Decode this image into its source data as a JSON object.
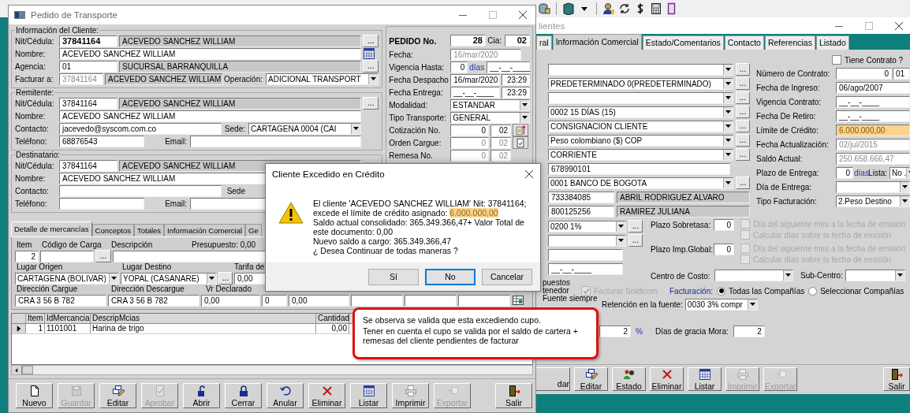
{
  "pedido": {
    "title": "Pedido de Transporte",
    "sections": [
      {
        "legend": "Información del Cliente:",
        "rows": [
          [
            {
              "kind": "label",
              "text": "Nit/Cédula:"
            },
            {
              "kind": "key",
              "text": "37841164"
            },
            {
              "kind": "readonly",
              "text": "ACEVEDO SANCHEZ WILLIAM"
            },
            {
              "kind": "button",
              "text": "..."
            }
          ],
          [
            {
              "kind": "label",
              "text": "Nombre:"
            },
            {
              "kind": "field",
              "text": "ACEVEDO SANCHEZ WILLIAM"
            }
          ],
          [
            {
              "kind": "label",
              "text": "Agencia:"
            },
            {
              "kind": "field",
              "text": "01"
            },
            {
              "kind": "readonly",
              "text": "SUCURSAL BARRANQUILLA"
            },
            {
              "kind": "button",
              "text": "..."
            }
          ],
          [
            {
              "kind": "label",
              "text": "Facturar a:"
            },
            {
              "kind": "field-grey",
              "text": "37841164"
            },
            {
              "kind": "readonly",
              "text": "ACEVEDO SANCHEZ WILLIAM"
            },
            {
              "kind": "label",
              "text": "Operación:"
            },
            {
              "kind": "combo",
              "text": "ADICIONAL TRANSPORT"
            }
          ]
        ]
      },
      {
        "legend": "Remitente:",
        "rows": [
          [
            {
              "kind": "label",
              "text": "Nit/Cédula:"
            },
            {
              "kind": "field",
              "text": "37841164"
            },
            {
              "kind": "readonly",
              "text": "ACEVEDO SANCHEZ WILLIAM"
            },
            {
              "kind": "button",
              "text": "..."
            }
          ],
          [
            {
              "kind": "label",
              "text": "Nombre:"
            },
            {
              "kind": "field",
              "text": "ACEVEDO SANCHEZ WILLIAM"
            }
          ],
          [
            {
              "kind": "label",
              "text": "Contacto:"
            },
            {
              "kind": "field",
              "text": "jacevedo@syscom.com.co"
            },
            {
              "kind": "label",
              "text": "Sede:"
            },
            {
              "kind": "combo",
              "text": "CARTAGENA 0004 (CAI"
            }
          ],
          [
            {
              "kind": "label",
              "text": "Teléfono:"
            },
            {
              "kind": "field",
              "text": "68876543"
            },
            {
              "kind": "label",
              "text": "Email:"
            },
            {
              "kind": "field"
            }
          ]
        ]
      },
      {
        "legend": "Destinatario:",
        "rows": [
          [
            {
              "kind": "label",
              "text": "Nit/Cédula:"
            },
            {
              "kind": "field",
              "text": "37841164"
            },
            {
              "kind": "readonly",
              "text": "ACEVEDO SANCHEZ WILLIAM"
            }
          ],
          [
            {
              "kind": "label",
              "text": "Nombre:"
            },
            {
              "kind": "field",
              "text": "ACEVEDO SANCHEZ WILLIAM"
            }
          ],
          [
            {
              "kind": "label",
              "text": "Contacto:"
            },
            {
              "kind": "field"
            },
            {
              "kind": "label",
              "text": "Sede"
            }
          ],
          [
            {
              "kind": "label",
              "text": "Teléfono:"
            },
            {
              "kind": "field"
            },
            {
              "kind": "label",
              "text": "Email:"
            },
            {
              "kind": "field"
            }
          ]
        ]
      }
    ],
    "order": [
      [
        {
          "kind": "strong",
          "text": "PEDIDO No."
        },
        {
          "kind": "key-number",
          "text": "28"
        },
        {
          "kind": "label",
          "text": "Cia:"
        },
        {
          "kind": "key-number",
          "text": "02"
        }
      ],
      [
        {
          "kind": "label",
          "text": "Fecha:"
        },
        {
          "kind": "field-grey",
          "text": "16/mar/2020"
        }
      ],
      [
        {
          "kind": "label",
          "text": "Vigencia Hasta:"
        },
        {
          "kind": "number",
          "text": "0"
        },
        {
          "kind": "unit",
          "text": "días"
        },
        {
          "kind": "field",
          "text": "__-__-____"
        }
      ],
      [
        {
          "kind": "label",
          "text": "Fecha Despacho"
        },
        {
          "kind": "field",
          "text": "16/mar/2020"
        },
        {
          "kind": "number",
          "text": "23:29"
        }
      ],
      [
        {
          "kind": "label",
          "text": "Fecha Entrega:"
        },
        {
          "kind": "field",
          "text": "__-__-____"
        },
        {
          "kind": "number",
          "text": "23:29"
        }
      ],
      [
        {
          "kind": "label",
          "text": "Modalidad:"
        },
        {
          "kind": "combo",
          "text": "ESTANDAR"
        }
      ],
      [
        {
          "kind": "label",
          "text": "Tipo Transporte:"
        },
        {
          "kind": "combo",
          "text": "GENERAL"
        }
      ],
      [
        {
          "kind": "label",
          "text": "Cotización No."
        },
        {
          "kind": "number",
          "text": "0"
        },
        {
          "kind": "number",
          "text": "02"
        }
      ],
      [
        {
          "kind": "label",
          "text": "Orden Cargue:"
        },
        {
          "kind": "number-grey",
          "text": "0"
        },
        {
          "kind": "number-grey",
          "text": "02"
        }
      ],
      [
        {
          "kind": "label",
          "text": "Remesa No."
        },
        {
          "kind": "number-grey",
          "text": "0"
        },
        {
          "kind": "number-grey",
          "text": "02"
        }
      ]
    ],
    "tabs": [
      {
        "label": "Detalle de mercancías",
        "selected": true
      },
      {
        "label": "Conceptos",
        "selected": false
      },
      {
        "label": "Totales",
        "selected": false
      },
      {
        "label": "Información Comercial",
        "selected": false
      },
      {
        "label": "Ge",
        "selected": false
      }
    ],
    "detail": [
      [
        {
          "kind": "label",
          "text": "Item"
        },
        {
          "kind": "label",
          "text": "Código de Carga"
        },
        {
          "kind": "label",
          "text": "Descripción"
        },
        {
          "kind": "label",
          "text": "Presupuesto: 0,00"
        }
      ],
      [
        {
          "kind": "number",
          "text": "2"
        },
        {
          "kind": "field"
        },
        {
          "kind": "button",
          "text": "..."
        },
        {
          "kind": "field"
        }
      ],
      [
        {
          "kind": "label",
          "text": "Lugar Origen"
        },
        {
          "kind": "label",
          "text": "Lugar Destino"
        },
        {
          "kind": "label",
          "text": "Tarifa de"
        }
      ],
      [
        {
          "kind": "combo",
          "text": "CARTAGENA (BOLIVAR)"
        },
        {
          "kind": "combo",
          "text": "YOPAL (CASANARE)"
        },
        {
          "kind": "button",
          "text": "..."
        },
        {
          "kind": "field",
          "text": "0,00"
        }
      ],
      [
        {
          "kind": "label",
          "text": "Dirección Cargue"
        },
        {
          "kind": "label",
          "text": "Dirección Descargue"
        },
        {
          "kind": "label",
          "text": "Vr Declarado"
        }
      ],
      [
        {
          "kind": "field",
          "text": "CRA 3 56 B 782"
        },
        {
          "kind": "field",
          "text": "CRA 3 56 B 782"
        },
        {
          "kind": "field",
          "text": "0,00"
        },
        {
          "kind": "field",
          "text": "0"
        },
        {
          "kind": "field",
          "text": "0,00"
        },
        {
          "kind": "field"
        },
        {
          "kind": "field"
        },
        {
          "kind": "field"
        }
      ]
    ],
    "grid": {
      "columns": [
        "Item",
        "IdMercancia",
        "DescripMcias",
        "Cantidad"
      ],
      "rows": [
        {
          "cells": [
            "1",
            "1101001",
            "Harina de trigo",
            "0,00"
          ],
          "selected": true
        }
      ]
    },
    "buttons": [
      {
        "label": "Nuevo",
        "disabled": false
      },
      {
        "label": "Guardar",
        "disabled": true
      },
      {
        "label": "Editar",
        "disabled": false
      },
      {
        "label": "Aprobar",
        "disabled": true
      },
      {
        "label": "Abrir",
        "disabled": false
      },
      {
        "label": "Cerrar",
        "disabled": false
      },
      {
        "label": "Anular",
        "disabled": false
      },
      {
        "label": "Eliminar",
        "disabled": false
      },
      {
        "label": "Listar",
        "disabled": false
      },
      {
        "label": "Imprimir",
        "disabled": false
      },
      {
        "label": "Exportar",
        "disabled": true
      },
      {
        "label": "Salir",
        "disabled": false
      }
    ]
  },
  "clientes": {
    "title": "lientes",
    "tabs": [
      {
        "label": "ral",
        "selected": false
      },
      {
        "label": "Información Comercial",
        "selected": true
      },
      {
        "label": "Estado/Comentarios",
        "selected": false
      },
      {
        "label": "Contacto",
        "selected": false
      },
      {
        "label": "Referencias",
        "selected": false
      },
      {
        "label": "Listado",
        "selected": false
      }
    ],
    "left_rows": [
      [
        {
          "kind": "combo"
        },
        {
          "kind": "button",
          "text": "..."
        }
      ],
      [
        {
          "kind": "combo",
          "text": "PREDETERMINADO 0(PREDETERMINADO)"
        },
        {
          "kind": "button",
          "text": "..."
        }
      ],
      [
        {
          "kind": "combo"
        },
        {
          "kind": "button",
          "text": "..."
        }
      ],
      [
        {
          "kind": "combo",
          "text": "0002 15 DÍAS (15)"
        },
        {
          "kind": "button",
          "text": "..."
        }
      ],
      [
        {
          "kind": "combo",
          "text": "CONSIGNACION CLIENTE"
        },
        {
          "kind": "button",
          "text": "..."
        }
      ],
      [
        {
          "kind": "combo",
          "text": "Peso colombiano ($) COP"
        },
        {
          "kind": "button",
          "text": "..."
        }
      ],
      [
        {
          "kind": "combo",
          "text": "CORRIENTE"
        },
        {
          "kind": "button",
          "text": "..."
        }
      ],
      [
        {
          "kind": "field",
          "text": "678990101"
        }
      ],
      [
        {
          "kind": "combo",
          "text": "0001 BANCO DE BOGOTA"
        },
        {
          "kind": "button",
          "text": "..."
        }
      ],
      [
        {
          "kind": "field",
          "text": "733384085"
        },
        {
          "kind": "readonly",
          "text": "ABRIL RODRIGUEZ ALVARO"
        }
      ],
      [
        {
          "kind": "field",
          "text": "800125256"
        },
        {
          "kind": "readonly",
          "text": "RAMIREZ JULIANA"
        }
      ]
    ],
    "contract": {
      "label": "Tiene Contrato ?",
      "checked": false
    },
    "right_rows": [
      [
        {
          "kind": "label",
          "text": "Número de Contrato:"
        },
        {
          "kind": "number",
          "text": "0"
        },
        {
          "kind": "field",
          "text": "01"
        }
      ],
      [
        {
          "kind": "label",
          "text": "Fecha de Ingreso:"
        },
        {
          "kind": "field",
          "text": "06/ago/2007"
        }
      ],
      [
        {
          "kind": "label",
          "text": "Vigencia Contrato:"
        },
        {
          "kind": "field",
          "text": "__-__-____"
        }
      ],
      [
        {
          "kind": "label",
          "text": "Fecha De Retiro:"
        },
        {
          "kind": "field",
          "text": "__-__-____"
        }
      ],
      [
        {
          "kind": "label",
          "text": "Límite de Crédito:"
        },
        {
          "kind": "highlight",
          "text": "6.000.000,00"
        }
      ],
      [
        {
          "kind": "label",
          "text": "Fecha Actualización:"
        },
        {
          "kind": "field-grey",
          "text": "02/jul/2015"
        }
      ],
      [
        {
          "kind": "label",
          "text": "Saldo Actual:"
        },
        {
          "kind": "field-grey",
          "text": "250.658.666,47"
        }
      ],
      [
        {
          "kind": "label",
          "text": "Plazo de Entrega:"
        },
        {
          "kind": "number",
          "text": "0"
        },
        {
          "kind": "unit",
          "text": "días"
        },
        {
          "kind": "label",
          "text": "Lista:"
        },
        {
          "kind": "combo",
          "text": "No ."
        }
      ],
      [
        {
          "kind": "label",
          "text": "Día de Entrega:"
        },
        {
          "kind": "combo"
        }
      ],
      [
        {
          "kind": "label",
          "text": "Tipo Facturación:"
        },
        {
          "kind": "combo",
          "text": "2.Peso Destino"
        }
      ]
    ],
    "lower_left_rows": [
      [
        {
          "kind": "combo",
          "text": "0200 1%"
        },
        {
          "kind": "button",
          "text": "..."
        }
      ],
      [
        {
          "kind": "combo"
        },
        {
          "kind": "button",
          "text": "..."
        }
      ],
      [
        {
          "kind": "field"
        }
      ],
      [
        {
          "kind": "field",
          "text": "__-__-____"
        }
      ]
    ],
    "plazos": [
      {
        "label": "Plazo Sobretasa:",
        "value": "0",
        "options": [
          {
            "label": "Día del siguiente mes a la fecha de emisión",
            "checked": false,
            "disabled": true
          },
          {
            "label": "Calcular días sobre la fecha de emisión",
            "checked": false,
            "disabled": true
          }
        ]
      },
      {
        "label": "Plazo Imp.Global:",
        "value": "0",
        "options": [
          {
            "label": "Día del siguiente mes a la fecha de emisión",
            "checked": false,
            "disabled": true
          },
          {
            "label": "Calcular días sobre la fecha de emisión",
            "checked": false,
            "disabled": true
          }
        ]
      }
    ],
    "centro": {
      "label": "Centro de Costo:"
    },
    "subcentro": {
      "label": "Sub-Centro:"
    },
    "fragments": [
      "puestos",
      "tenedor",
      "Fuente siempre"
    ],
    "soldicom": {
      "label": "Facturar Soldicom",
      "checked": true,
      "disabled": true
    },
    "facturacion": {
      "label": "Facturación:",
      "options": [
        {
          "label": "Todas las Compañías",
          "selected": true
        },
        {
          "label": "Seleccionar Compañías",
          "selected": false
        }
      ]
    },
    "retencion": {
      "label": "Retención en la fuente:",
      "value": "0030  3% compr"
    },
    "mora": {
      "value": "2",
      "unit": "%",
      "label": "Días de gracia Mora:",
      "days": "2"
    },
    "buttons": [
      {
        "label": "dar",
        "disabled": false
      },
      {
        "label": "Editar",
        "disabled": false
      },
      {
        "label": "Estado",
        "disabled": false
      },
      {
        "label": "Eliminar",
        "disabled": false
      },
      {
        "label": "Listar",
        "disabled": false
      },
      {
        "label": "Imprimir",
        "disabled": true
      },
      {
        "label": "Exportar",
        "disabled": true
      },
      {
        "label": "Salir",
        "disabled": false
      }
    ]
  },
  "dialog": {
    "title": "Cliente Excedido en Crédito",
    "lead": "El cliente 'ACEVEDO SANCHEZ WILLIAM' Nit: 37841164; excede el límite de crédito asignado:",
    "amount": "6.000.000,00",
    "lines": [
      "Saldo actual consolidado: 365.349.366,47+ Valor Total de este documento: 0,00",
      "Nuevo saldo a cargo: 365.349.366,47",
      "¿ Desea Continuar de todas maneras ?"
    ],
    "buttons": [
      {
        "label": "Sí",
        "focused": false
      },
      {
        "label": "No",
        "focused": true
      },
      {
        "label": "Cancelar",
        "focused": false
      }
    ]
  },
  "callout": {
    "lines": [
      "Se observa se valida que esta excediendo cupo.",
      "Tener en cuenta el cupo se valida por el saldo de cartera + remesas del cliente pendientes de facturar"
    ]
  }
}
